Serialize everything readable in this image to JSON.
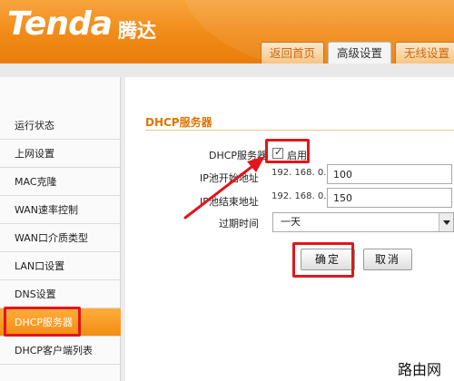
{
  "header": {
    "logo": "Tenda",
    "logo_cn": "腾达",
    "tabs": [
      {
        "label": "返回首页",
        "active": false
      },
      {
        "label": "高级设置",
        "active": true
      },
      {
        "label": "无线设置",
        "active": false
      }
    ]
  },
  "sidebar": {
    "items": [
      {
        "label": "运行状态"
      },
      {
        "label": "上网设置"
      },
      {
        "label": "MAC克隆"
      },
      {
        "label": "WAN速率控制"
      },
      {
        "label": "WAN口介质类型"
      },
      {
        "label": "LAN口设置"
      },
      {
        "label": "DNS设置"
      },
      {
        "label": "DHCP服务器",
        "active": true
      },
      {
        "label": "DHCP客户端列表"
      }
    ]
  },
  "form": {
    "title": "DHCP服务器",
    "dhcp_label": "DHCP服务器",
    "enable_label": "启用",
    "enabled": true,
    "start_label": "IP池开始地址",
    "start_prefix": "192. 168. 0.",
    "start_value": "100",
    "end_label": "IP池结束地址",
    "end_prefix": "192. 168. 0.",
    "end_value": "150",
    "lease_label": "过期时间",
    "lease_value": "一天",
    "ok_label": "确定",
    "cancel_label": "取消"
  },
  "watermark": "路由网",
  "colors": {
    "brand_orange": "#f08a17",
    "title_orange": "#e17300",
    "annotation_red": "#e0161b"
  }
}
